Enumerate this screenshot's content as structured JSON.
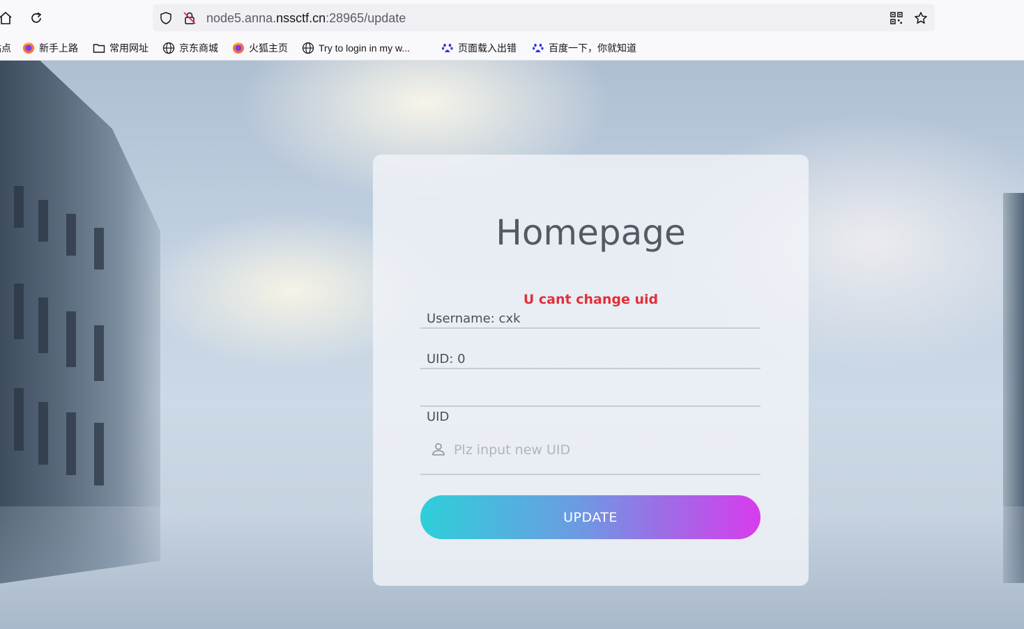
{
  "browser": {
    "url_prefix": "node5.anna.",
    "url_domain": "nssctf.cn",
    "url_suffix": ":28965/update"
  },
  "bookmarks": [
    {
      "label": "站点",
      "icon": "truncated-icon"
    },
    {
      "label": "新手上路",
      "icon": "firefox-icon"
    },
    {
      "label": "常用网址",
      "icon": "folder-icon"
    },
    {
      "label": "京东商城",
      "icon": "globe-icon"
    },
    {
      "label": "火狐主页",
      "icon": "firefox-icon"
    },
    {
      "label": "Try to login in my w...",
      "icon": "globe-icon"
    },
    {
      "label": "页面载入出错",
      "icon": "baidu-paw-icon"
    },
    {
      "label": "百度一下，你就知道",
      "icon": "baidu-paw-icon"
    }
  ],
  "card": {
    "title": "Homepage",
    "error": "U cant change uid",
    "username_line": "Username: cxk",
    "uid_line": "UID:  0",
    "uid_label": "UID",
    "uid_placeholder": "Plz input new UID",
    "button_label": "UPDATE"
  },
  "colors": {
    "error": "#e0303a",
    "button_start": "#2ecfd9",
    "button_end": "#d83ced"
  }
}
